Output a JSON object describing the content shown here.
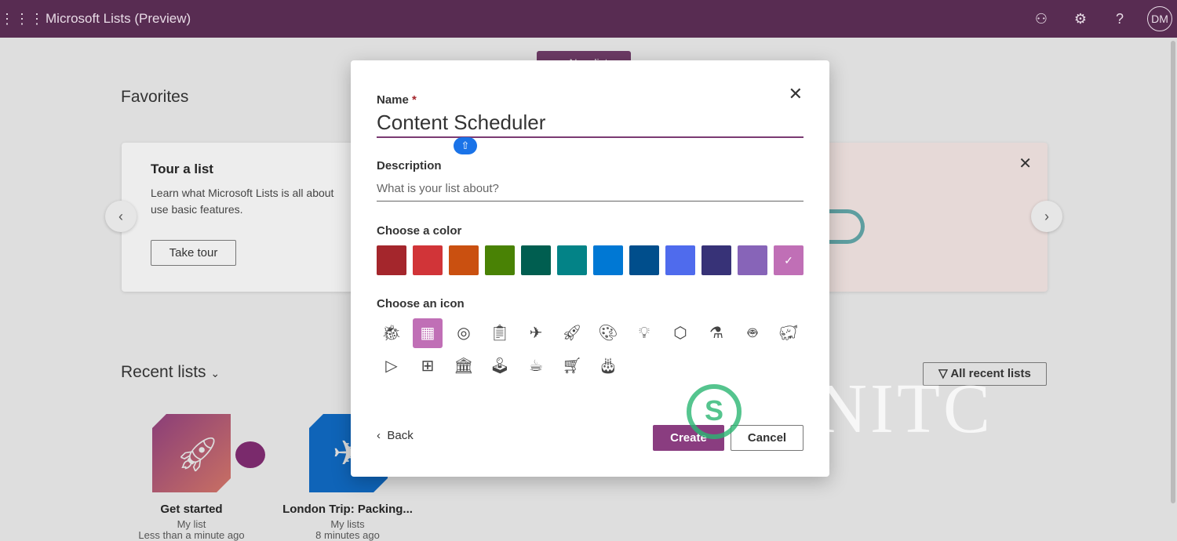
{
  "topbar": {
    "title": "Microsoft Lists (Preview)",
    "avatar": "DM",
    "icons": [
      "waffle-icon",
      "share-icon",
      "gear-icon",
      "help-icon"
    ]
  },
  "page": {
    "new_list": "+ New list",
    "favorites": "Favorites",
    "tour": {
      "title": "Tour a list",
      "text1": "Learn what Microsoft Lists is all about",
      "text2": "use basic features.",
      "button": "Take tour"
    },
    "recent": "Recent lists",
    "all_recent": "All recent lists",
    "lists": [
      {
        "name": "Get started",
        "sub": "My list",
        "time": "Less than a minute ago",
        "color": "#a24f80"
      },
      {
        "name": "London Trip: Packing...",
        "sub": "My lists",
        "time": "8 minutes ago",
        "color": "#0f64b8"
      }
    ]
  },
  "dialog": {
    "name_label": "Name",
    "required": "*",
    "name_value": "Content Scheduler",
    "description_label": "Description",
    "description_placeholder": "What is your list about?",
    "color_label": "Choose a color",
    "colors": [
      "#a4262c",
      "#d13438",
      "#ca5010",
      "#498205",
      "#005e50",
      "#038387",
      "#0078d4",
      "#004e8c",
      "#4f6bed",
      "#373277",
      "#8764b8",
      "#c06fb6"
    ],
    "selected_color": 11,
    "icon_label": "Choose an icon",
    "icons": [
      "bug",
      "calendar",
      "target",
      "clipboard",
      "airplane",
      "rocket",
      "palette",
      "lightbulb",
      "cube",
      "beaker",
      "robot",
      "piggy-bank",
      "play",
      "medical-kit",
      "bank",
      "joystick",
      "coffee",
      "cart",
      "cake"
    ],
    "selected_icon": 1,
    "back": "Back",
    "create": "Create",
    "cancel": "Cancel"
  },
  "watermark": "NITC"
}
